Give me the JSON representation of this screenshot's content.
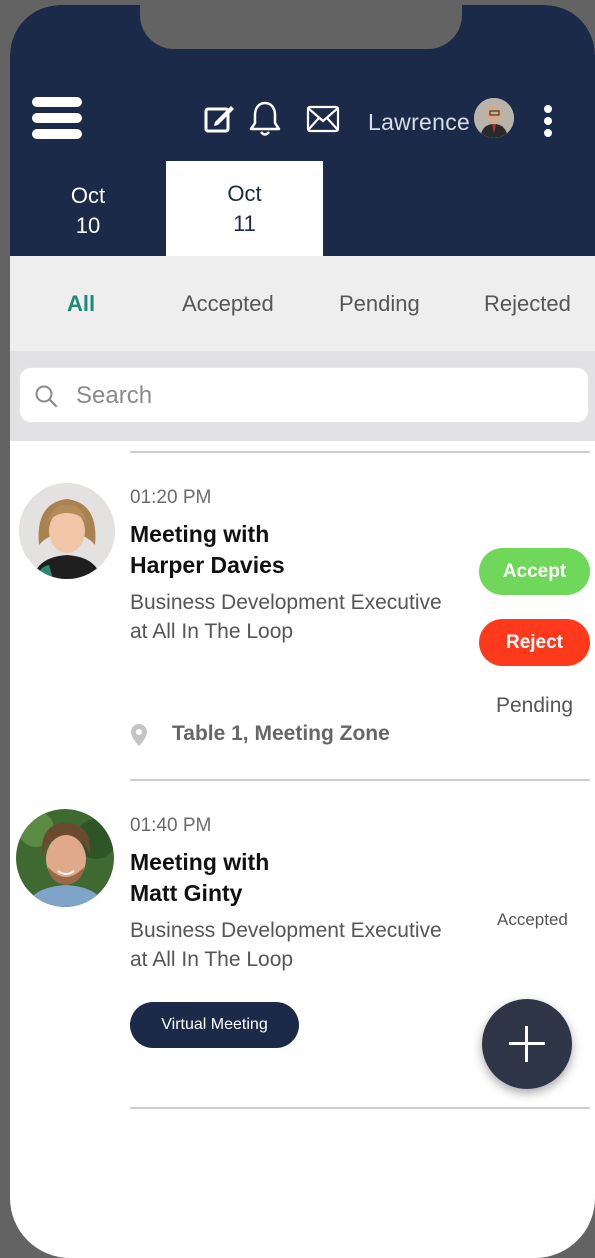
{
  "header": {
    "username": "Lawrence",
    "icons": [
      "menu-icon",
      "edit-icon",
      "bell-icon",
      "mail-icon",
      "avatar",
      "more-vertical-icon"
    ]
  },
  "date_tabs": [
    {
      "month": "Oct",
      "day": "10",
      "active": false
    },
    {
      "month": "Oct",
      "day": "11",
      "active": true
    }
  ],
  "filters": {
    "all": "All",
    "accepted": "Accepted",
    "pending": "Pending",
    "rejected": "Rejected",
    "active": "All"
  },
  "search": {
    "placeholder": "Search"
  },
  "meetings": [
    {
      "time": "01:20 PM",
      "title_line1": "Meeting with",
      "title_line2": "Harper Davies",
      "role_line1": "Business Development Executive",
      "role_line2": "at  All In The Loop",
      "accept_label": "Accept",
      "reject_label": "Reject",
      "status": "Pending",
      "location": "Table 1, Meeting Zone"
    },
    {
      "time": "01:40 PM",
      "title_line1": "Meeting with",
      "title_line2": "Matt Ginty",
      "role_line1": "Business Development Executive",
      "role_line2": "at  All In The Loop",
      "status": "Accepted",
      "virtual_label": "Virtual Meeting"
    }
  ],
  "colors": {
    "header_bg": "#1c2a4a",
    "accent_green": "#1e8a78",
    "accept": "#6fd85a",
    "reject": "#ff3a1c",
    "fab": "#2d3547"
  }
}
